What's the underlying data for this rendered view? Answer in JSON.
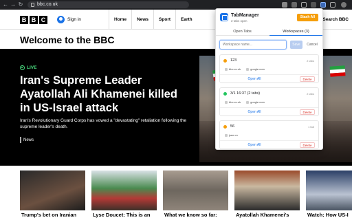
{
  "browser": {
    "url": "bbc.co.uk"
  },
  "bbc": {
    "logo": [
      "B",
      "B",
      "C"
    ],
    "signin": "Sign in",
    "nav": [
      "Home",
      "News",
      "Sport",
      "Earth"
    ],
    "search": "Search BBC",
    "welcome": "Welcome to the BBC",
    "hero": {
      "live": "LIVE",
      "headline": "Iran's Supreme Leader Ayatollah Ali Khamenei killed in US-Israel attack",
      "summary": "Iran's Revolutionary Guard Corps has vowed a \"devastating\" retaliation following the supreme leader's death.",
      "tag": "News"
    },
    "cards": [
      {
        "title": "Trump's bet on Iranian"
      },
      {
        "title": "Lyse Doucet: This is an"
      },
      {
        "title": "What we know so far:"
      },
      {
        "title": "Ayatollah Khamenei's"
      },
      {
        "title": "Watch: How US-I"
      }
    ]
  },
  "popup": {
    "title": "TabManager",
    "subtitle": "2 tabs open",
    "stash_label": "Stash All",
    "tabs": [
      "Open Tabs",
      "Workspaces (3)"
    ],
    "input_placeholder": "Workspace name...",
    "save_label": "Save",
    "cancel_label": "Cancel",
    "workspaces": [
      {
        "name": "123",
        "count": "2 tabs",
        "color": "#f59e0b",
        "tabs": [
          "bbc.co.uk",
          "google.com"
        ],
        "open_label": "Open All",
        "delete_label": "Delete"
      },
      {
        "name": "3/1 16:37 (2 tabs)",
        "count": "2 tabs",
        "color": "#22c55e",
        "tabs": [
          "bbc.co.uk",
          "google.com"
        ],
        "open_label": "Open All",
        "delete_label": "Delete"
      },
      {
        "name": "56",
        "count": "1 tab",
        "color": "#f59e0b",
        "tabs": [
          "jsee.cn"
        ],
        "open_label": "Open All",
        "delete_label": "Delete"
      }
    ]
  }
}
